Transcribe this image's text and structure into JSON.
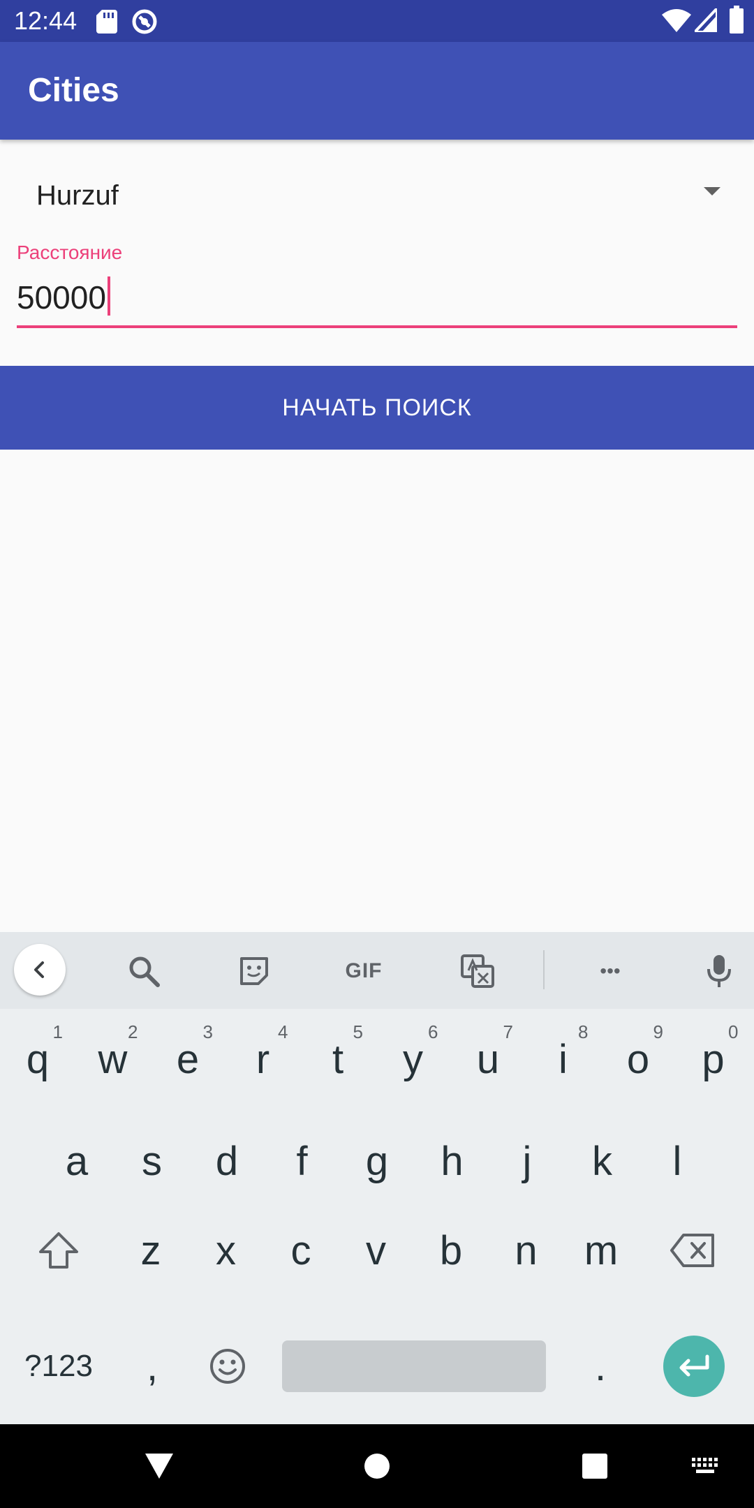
{
  "status_bar": {
    "time": "12:44",
    "icons": [
      "sd-card-icon",
      "sync-icon",
      "wifi-icon",
      "signal-icon",
      "battery-icon"
    ]
  },
  "app_bar": {
    "title": "Cities"
  },
  "form": {
    "city_spinner": {
      "selected": "Hurzuf"
    },
    "distance_field": {
      "label": "Расстояние",
      "value": "50000"
    },
    "search_button": {
      "label": "НАЧАТЬ ПОИСК"
    }
  },
  "keyboard": {
    "toolbar_icons": [
      "back-icon",
      "search-icon",
      "sticker-icon",
      "gif-icon",
      "translate-icon",
      "more-icon",
      "mic-icon"
    ],
    "gif_label": "GIF",
    "more_label": "•••",
    "row1": [
      {
        "k": "q",
        "h": "1"
      },
      {
        "k": "w",
        "h": "2"
      },
      {
        "k": "e",
        "h": "3"
      },
      {
        "k": "r",
        "h": "4"
      },
      {
        "k": "t",
        "h": "5"
      },
      {
        "k": "y",
        "h": "6"
      },
      {
        "k": "u",
        "h": "7"
      },
      {
        "k": "i",
        "h": "8"
      },
      {
        "k": "o",
        "h": "9"
      },
      {
        "k": "p",
        "h": "0"
      }
    ],
    "row2": [
      "a",
      "s",
      "d",
      "f",
      "g",
      "h",
      "j",
      "k",
      "l"
    ],
    "row3": [
      "z",
      "x",
      "c",
      "v",
      "b",
      "n",
      "m"
    ],
    "symbols_key": "?123",
    "comma_key": ",",
    "period_key": "."
  },
  "colors": {
    "status_bar": "#303F9F",
    "primary": "#3F51B5",
    "accent": "#EC407A",
    "enter_key": "#4DB6AC"
  }
}
